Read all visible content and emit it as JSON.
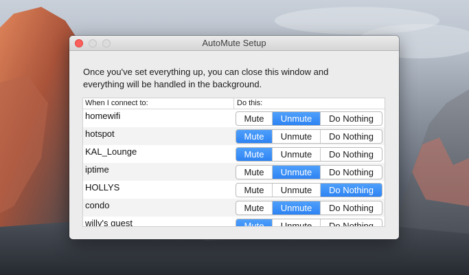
{
  "window": {
    "title": "AutoMute Setup",
    "intro_line1": "Once you've set everything up, you can close this window and",
    "intro_line2": "everything will be handled in the background."
  },
  "table": {
    "header_network": "When I connect to:",
    "header_action": "Do this:",
    "options": [
      "Mute",
      "Unmute",
      "Do Nothing"
    ],
    "rows": [
      {
        "network": "homewifi",
        "selected": "Unmute"
      },
      {
        "network": "hotspot",
        "selected": "Mute"
      },
      {
        "network": "KAL_Lounge",
        "selected": "Mute"
      },
      {
        "network": "iptime",
        "selected": "Unmute"
      },
      {
        "network": "HOLLYS",
        "selected": "Do Nothing"
      },
      {
        "network": "condo",
        "selected": "Unmute"
      },
      {
        "network": "willy's guest",
        "selected": "Mute"
      }
    ]
  },
  "colors": {
    "selected_segment": "#2d83f3",
    "close_button": "#fc605c"
  },
  "icons": {
    "close": "close-icon",
    "minimize": "minimize-icon",
    "zoom": "zoom-icon"
  }
}
